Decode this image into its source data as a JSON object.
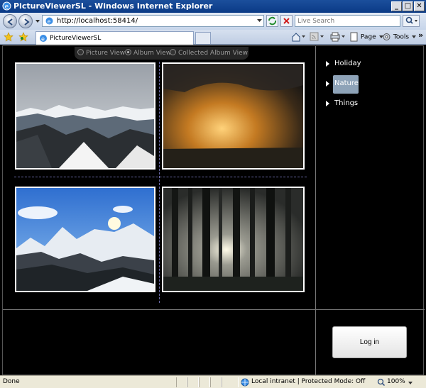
{
  "window": {
    "title": "PictureViewerSL - Windows Internet Explorer",
    "min_glyph": "_",
    "max_glyph": "□",
    "close_glyph": "✕"
  },
  "address": {
    "url": "http://localhost:58414/"
  },
  "search": {
    "placeholder": "Live Search"
  },
  "tab": {
    "title": "PictureViewerSL"
  },
  "commands": {
    "page": "Page",
    "tools": "Tools",
    "more": "»"
  },
  "view_modes": [
    {
      "label": "Picture View",
      "selected": false
    },
    {
      "label": "Album View",
      "selected": true
    },
    {
      "label": "Collected Album View",
      "selected": false
    }
  ],
  "categories": [
    {
      "label": "Holiday",
      "selected": false
    },
    {
      "label": "Nature",
      "selected": true
    },
    {
      "label": "Things",
      "selected": false
    }
  ],
  "photos": [
    {
      "subject": "snowy mountain range under overcast sky"
    },
    {
      "subject": "golden sunset through dark clouds"
    },
    {
      "subject": "snowy peaks with blue sky and sun"
    },
    {
      "subject": "sunbeams through forest trees"
    }
  ],
  "login": {
    "label": "Log in"
  },
  "status": {
    "left": "Done",
    "zone": "Local intranet | Protected Mode: Off",
    "zoom": "100%"
  },
  "colors": {
    "titlebar": "#0a3a86",
    "selected_category": "#8ea3b8",
    "splitter": "#6a6aa8"
  }
}
